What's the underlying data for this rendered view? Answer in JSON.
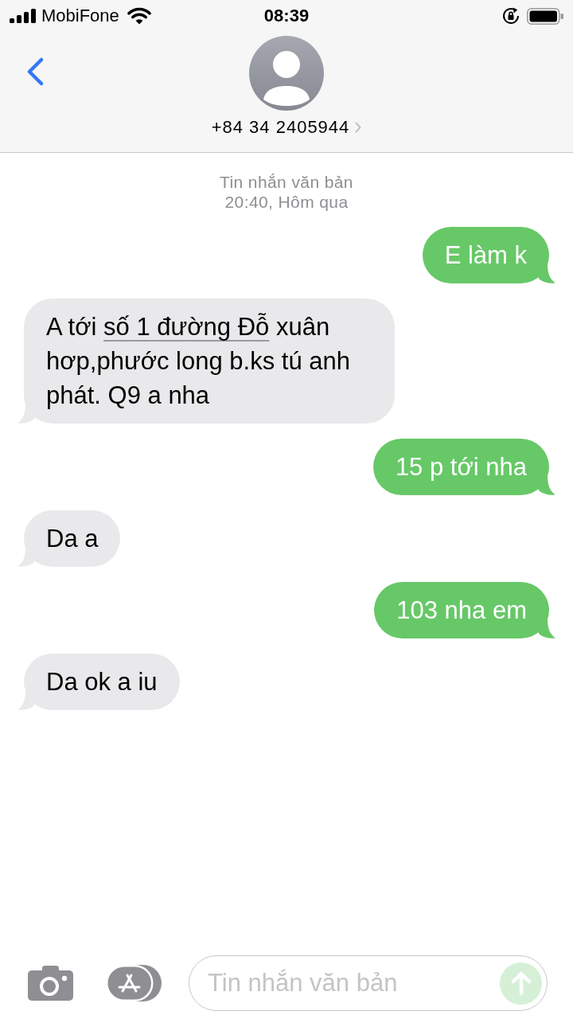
{
  "status_bar": {
    "carrier": "MobiFone",
    "time": "08:39"
  },
  "header": {
    "contact": "+84 34 2405944"
  },
  "conversation": {
    "service": "Tin nhắn văn bản",
    "timestamp": "20:40, Hôm qua"
  },
  "messages": [
    {
      "kind": "sent",
      "parts": [
        {
          "kind": "text",
          "text": "E làm k"
        }
      ]
    },
    {
      "kind": "received",
      "parts": [
        {
          "kind": "text",
          "text": "A tới "
        },
        {
          "kind": "link",
          "text": "số 1 đường Đỗ"
        },
        {
          "kind": "text",
          "text": " xuân hơp,phước long b.ks tú anh phát. Q9 a nha"
        }
      ]
    },
    {
      "kind": "sent",
      "parts": [
        {
          "kind": "text",
          "text": "15 p tới nha"
        }
      ]
    },
    {
      "kind": "received",
      "parts": [
        {
          "kind": "text",
          "text": "Da a"
        }
      ]
    },
    {
      "kind": "sent",
      "parts": [
        {
          "kind": "text",
          "text": "103 nha em"
        }
      ]
    },
    {
      "kind": "received",
      "parts": [
        {
          "kind": "text",
          "text": "Da ok a iu"
        }
      ]
    }
  ],
  "composer": {
    "placeholder": "Tin nhắn văn bản",
    "send_button": {
      "disabled": true
    }
  }
}
